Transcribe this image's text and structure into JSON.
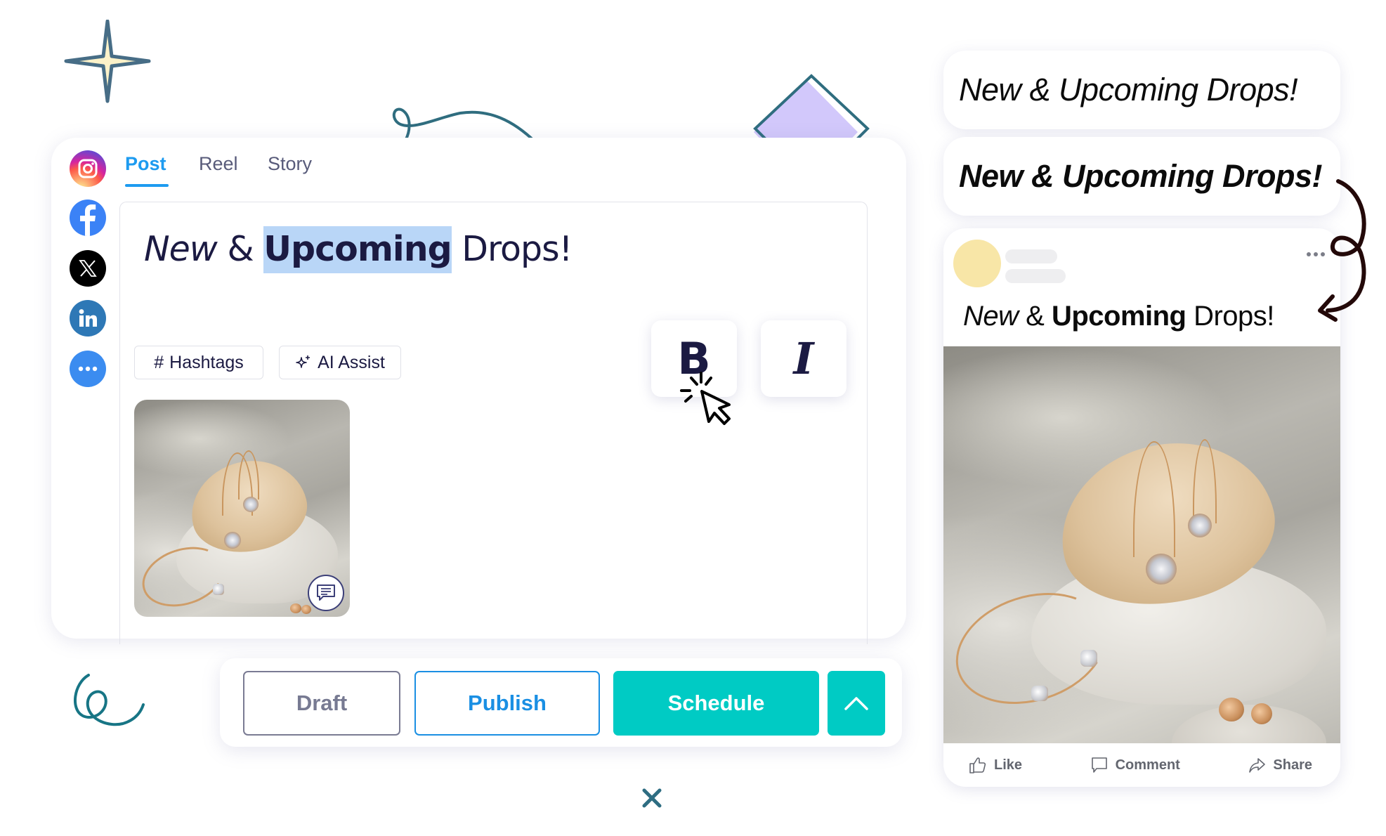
{
  "composer": {
    "platforms": [
      {
        "name": "Instagram",
        "icon": "instagram-icon",
        "color": "#d6249f"
      },
      {
        "name": "Facebook",
        "icon": "facebook-icon",
        "color": "#3b82f6"
      },
      {
        "name": "X",
        "icon": "x-icon",
        "color": "#000000"
      },
      {
        "name": "LinkedIn",
        "icon": "linkedin-icon",
        "color": "#2e78b6"
      },
      {
        "name": "More",
        "icon": "more-icon",
        "color": "#3b8cf0"
      }
    ],
    "tabs": [
      {
        "label": "Post",
        "active": true
      },
      {
        "label": "Reel",
        "active": false
      },
      {
        "label": "Story",
        "active": false
      }
    ],
    "editor": {
      "text_italic": "New",
      "text_amp": " & ",
      "text_selected": "Upcoming",
      "text_rest": " Drops!"
    },
    "chips": {
      "hashtags_symbol": "#",
      "hashtags_label": "Hashtags",
      "ai_label": "AI Assist"
    },
    "format_buttons": {
      "bold_label": "B",
      "italic_label": "I"
    }
  },
  "actions": {
    "draft": "Draft",
    "publish": "Publish",
    "schedule": "Schedule"
  },
  "preview": {
    "headline_italic": "New & Upcoming Drops!",
    "headline_bold_italic": "New & Upcoming Drops!",
    "post_text_italic": "New",
    "post_text_amp": " & ",
    "post_text_bold": "Upcoming",
    "post_text_rest": " Drops!",
    "like": "Like",
    "comment": "Comment",
    "share": "Share"
  },
  "colors": {
    "accent_blue": "#1d9bf0",
    "schedule_teal": "#00cbc4",
    "selection": "#b9d6f7",
    "text_navy": "#1b1a42"
  }
}
